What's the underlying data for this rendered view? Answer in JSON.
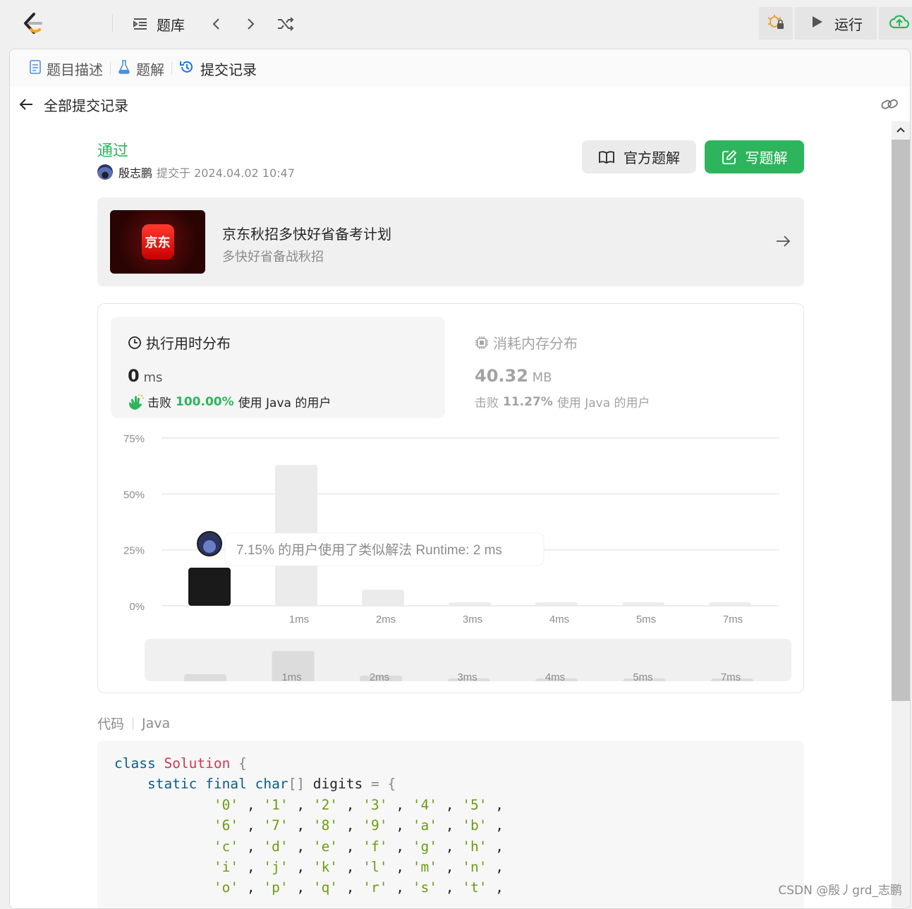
{
  "topbar": {
    "problem_bank_label": "题库",
    "run_label": "运行"
  },
  "tabs": [
    {
      "label": "题目描述"
    },
    {
      "label": "题解"
    },
    {
      "label": "提交记录"
    }
  ],
  "subheader": {
    "back_label": "全部提交记录"
  },
  "submission": {
    "status": "通过",
    "user": "殷志鹏",
    "submitted_text": "提交于 2024.04.02 10:47",
    "official_solution_label": "官方题解",
    "write_solution_label": "写题解"
  },
  "banner": {
    "logo_text": "京东",
    "title": "京东秋招多快好省备考计划",
    "subtitle": "多快好省备战秋招"
  },
  "runtime": {
    "title": "执行用时分布",
    "value": "0",
    "unit": "ms",
    "beat_prefix": "击败",
    "beat_percent": "100.00%",
    "beat_suffix": "使用 Java 的用户"
  },
  "memory": {
    "title": "消耗内存分布",
    "value": "40.32",
    "unit": "MB",
    "beat_prefix": "击败",
    "beat_percent": "11.27%",
    "beat_suffix": "使用 Java 的用户"
  },
  "chart_data": {
    "type": "bar",
    "categories": [
      "",
      "1ms",
      "2ms",
      "3ms",
      "4ms",
      "5ms",
      "7ms"
    ],
    "values": [
      17,
      63,
      7.15,
      1.5,
      1.5,
      1.5,
      1.5
    ],
    "highlight_index": 0,
    "y_ticks": [
      "0%",
      "25%",
      "50%",
      "75%"
    ],
    "ylim": [
      0,
      75
    ],
    "tooltip": "7.15% 的用户使用了类似解法 Runtime: 2 ms",
    "mini_values": [
      10,
      43,
      8,
      4,
      4,
      4,
      4
    ]
  },
  "code": {
    "label": "代码",
    "language": "Java"
  },
  "watermark": "CSDN @殷丿grd_志鹏",
  "colors": {
    "accepted_green": "#2db55d",
    "highlight_bar": "#1a1a1a",
    "bar": "#ebebeb"
  }
}
